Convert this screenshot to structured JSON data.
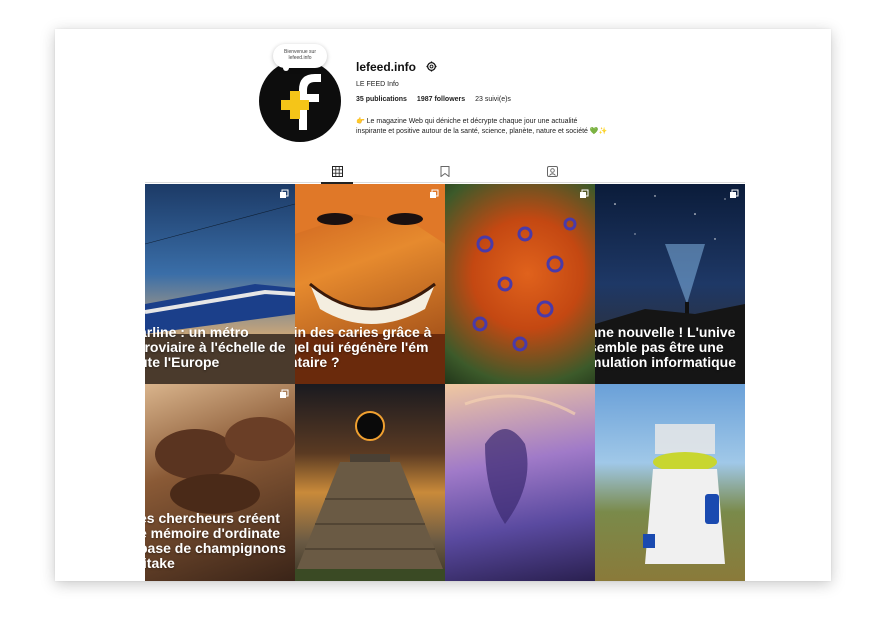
{
  "profile": {
    "note": "Bienvenue sur lefeed.info",
    "username": "lefeed.info",
    "full_name": "LE FEED Info",
    "stats": {
      "publications": "35 publications",
      "followers": "1987 followers",
      "following": "23 suivi(e)s"
    },
    "bio_line1": "👉 Le magazine Web qui déniche et décrypte chaque jour une actualité",
    "bio_line2": "inspirante et positive autour de la santé, science, planète, nature et société 💚✨"
  },
  "tabs": [
    {
      "icon": "grid-icon",
      "active": true
    },
    {
      "icon": "bookmark-icon",
      "active": false
    },
    {
      "icon": "tagged-icon",
      "active": false
    }
  ],
  "posts": [
    {
      "caption": [
        "arline : un métro",
        "rroviaire à l'échelle de",
        "ute l'Europe"
      ],
      "multi": true
    },
    {
      "caption": [
        "fin des caries grâce à",
        "gel qui régénère l'ém",
        "ntaire ?"
      ],
      "multi": true
    },
    {
      "caption": [],
      "multi": true
    },
    {
      "caption": [
        "nne nouvelle ! L'unive",
        " semble pas être une",
        "mulation informatique"
      ],
      "multi": true
    },
    {
      "caption": [
        "es chercheurs créent",
        "e mémoire d'ordinate",
        "base de champignons",
        "iitake"
      ],
      "multi": true
    },
    {
      "caption": [],
      "multi": false
    },
    {
      "caption": [],
      "multi": false
    },
    {
      "caption": [],
      "multi": false
    }
  ],
  "colors": {
    "accent_yellow": "#f5c518",
    "avatar_bg": "#0d0d0d"
  }
}
